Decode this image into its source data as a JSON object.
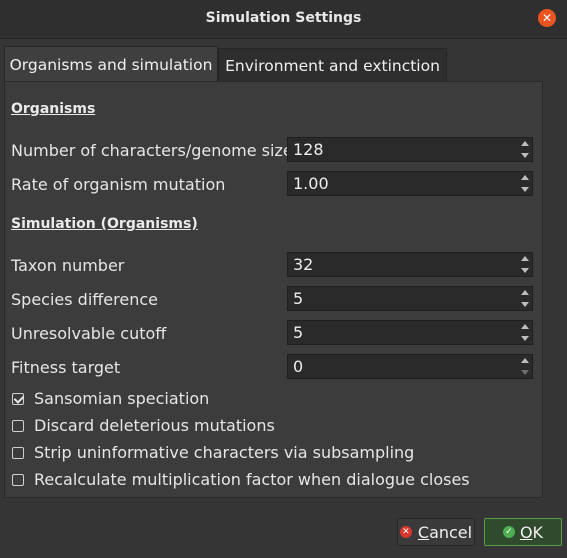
{
  "window": {
    "title": "Simulation Settings"
  },
  "tabs": [
    {
      "label": "Organisms and simulation"
    },
    {
      "label": "Environment and extinction"
    }
  ],
  "sections": {
    "organisms": "Organisms",
    "simulation": "Simulation (Organisms)"
  },
  "fields": {
    "genome_size": {
      "label": "Number of characters/genome size",
      "value": "128"
    },
    "mutation_rate": {
      "label": "Rate of organism mutation",
      "value": "1.00"
    },
    "taxon_number": {
      "label": "Taxon number",
      "value": "32"
    },
    "species_difference": {
      "label": "Species difference",
      "value": "5"
    },
    "unresolvable_cutoff": {
      "label": "Unresolvable cutoff",
      "value": "5"
    },
    "fitness_target": {
      "label": "Fitness target",
      "value": "0"
    }
  },
  "checkboxes": [
    {
      "label": "Sansomian speciation",
      "checked": true
    },
    {
      "label": "Discard deleterious mutations",
      "checked": false
    },
    {
      "label": "Strip uninformative characters via subsampling",
      "checked": false
    },
    {
      "label": "Recalculate multiplication factor when dialogue closes",
      "checked": false
    }
  ],
  "buttons": {
    "cancel_mnemonic": "C",
    "cancel_rest": "ancel",
    "ok_mnemonic": "O",
    "ok_rest": "K"
  },
  "colors": {
    "close_button": "#e95420",
    "ok_border": "#5a9c45",
    "cancel_icon": "#d9352a",
    "ok_icon": "#4caf50"
  }
}
